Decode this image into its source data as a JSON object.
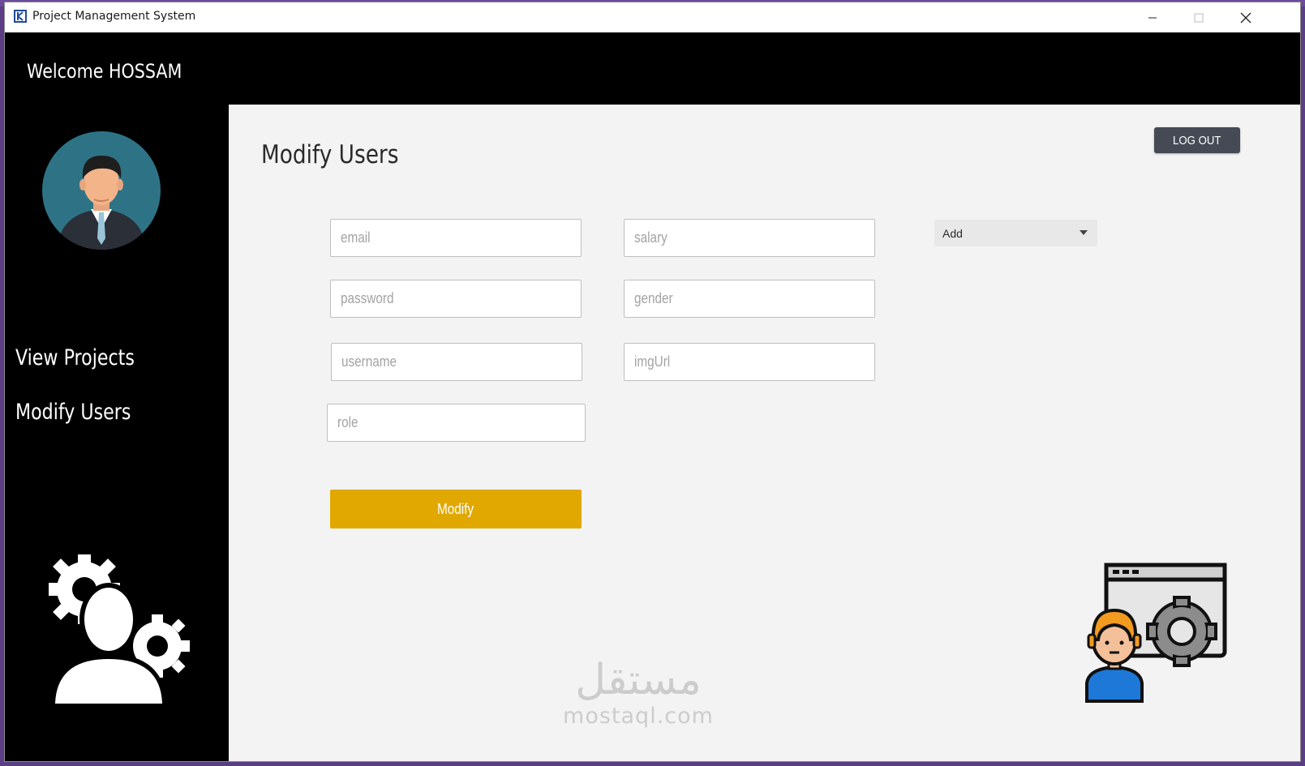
{
  "window": {
    "title": "Project Management System",
    "minimize": "minimize",
    "maximize": "maximize",
    "close": "close"
  },
  "header": {
    "welcome": "Welcome HOSSAM"
  },
  "sidebar": {
    "items": [
      {
        "label": "View Projects"
      },
      {
        "label": "Modify Users"
      }
    ]
  },
  "main": {
    "title": "Modify Users",
    "logout_label": "LOG OUT",
    "fields": {
      "email": {
        "placeholder": "email",
        "value": ""
      },
      "password": {
        "placeholder": "password",
        "value": ""
      },
      "username": {
        "placeholder": "username",
        "value": ""
      },
      "role": {
        "placeholder": "role",
        "value": ""
      },
      "salary": {
        "placeholder": "salary",
        "value": ""
      },
      "gender": {
        "placeholder": "gender",
        "value": ""
      },
      "imgUrl": {
        "placeholder": "imgUrl",
        "value": ""
      }
    },
    "action_select": {
      "selected": "Add"
    },
    "modify_label": "Modify"
  },
  "watermark": {
    "arabic": "مستقل",
    "latin": "mostaql.com"
  },
  "colors": {
    "sidebar": "#000000",
    "content_bg": "#f3f3f3",
    "accent": "#e0a800",
    "logout_bg": "#454a55"
  },
  "icons": [
    "app-icon",
    "avatar",
    "settings-users-icon",
    "developer-settings-icon",
    "caret-down-icon"
  ]
}
